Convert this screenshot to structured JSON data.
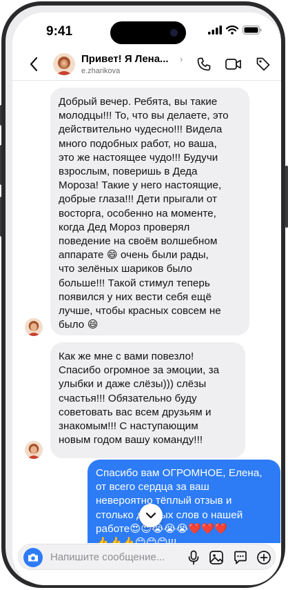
{
  "status_bar": {
    "time": "9:41"
  },
  "header": {
    "title": "Привет! Я Лена...",
    "chevron": "›",
    "subtitle": "e.zharikova"
  },
  "messages": [
    {
      "direction": "incoming",
      "text": "Добрый вечер. Ребята, вы такие\nмолодцы!!! То, что вы делаете, это\nдействительно чудесно!!! Видела\nмного подобных работ, но ваша,\nэто же настоящее чудо!!! Будучи\nвзрослым, поверишь в Деда\nМороза! Такие у него настоящие,\nдобрые глаза!!! Дети прыгали от\nвосторга, особенно на моменте,\nкогда Дед Мороз проверял\nповедение на своём волшебном\nаппарате 😄 очень были рады,\nчто зелёных шариков было\nбольше!!! Такой стимул теперь\nпоявился у них вести себя ещё\nлучше, чтобы красных совсем не\nбыло 😄"
    },
    {
      "direction": "incoming",
      "text": "Как же мне с вами повезло!\nСпасибо огромное за эмоции, за\nулыбки и даже слёзы))) слёзы\nсчастья!!! Обязательно буду\nсоветовать вас всем друзьям и\nзнакомым!!! С наступающим\nновым годом вашу команду!!!"
    },
    {
      "direction": "outgoing",
      "text": "Спасибо вам ОГРОМНОЕ, Елена,\nот всего сердца за ваш\nневероятно тёплый отзыв и\nстолько добрых слов о нашей\nработе😍😍😭😭😭❤️❤️❤️\n👍👍👍😊😊😊!!!"
    }
  ],
  "composer": {
    "placeholder": "Напишите сообщение..."
  },
  "colors": {
    "accent": "#2d7cf6",
    "incoming_bubble": "#efeff1",
    "outgoing_bubble": "#2d7cf6"
  },
  "icons": {
    "header": [
      "chevron-left-icon",
      "phone-icon",
      "video-icon",
      "tag-icon"
    ],
    "composer": [
      "camera-icon",
      "microphone-icon",
      "image-icon",
      "sticker-icon",
      "plus-circle-icon"
    ]
  }
}
